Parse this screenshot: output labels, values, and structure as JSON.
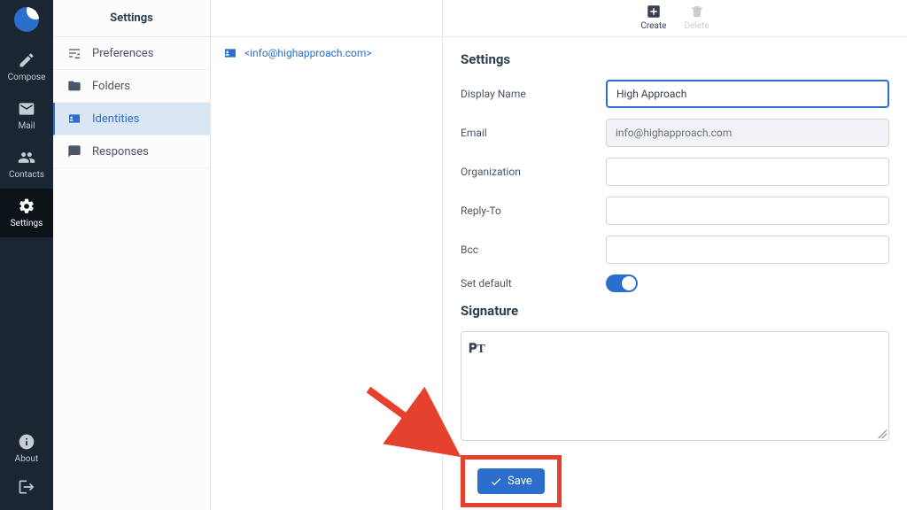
{
  "nav": {
    "compose": "Compose",
    "mail": "Mail",
    "contacts": "Contacts",
    "settings": "Settings",
    "about": "About"
  },
  "settings_col": {
    "title": "Settings",
    "items": [
      {
        "label": "Preferences"
      },
      {
        "label": "Folders"
      },
      {
        "label": "Identities"
      },
      {
        "label": "Responses"
      }
    ]
  },
  "identity_list": {
    "item_email": "<info@highapproach.com>"
  },
  "toolbar": {
    "create": "Create",
    "delete": "Delete"
  },
  "form": {
    "section_settings": "Settings",
    "display_name_label": "Display Name",
    "display_name_value": "High Approach",
    "email_label": "Email",
    "email_value": "info@highapproach.com",
    "organization_label": "Organization",
    "organization_value": "",
    "replyto_label": "Reply-To",
    "replyto_value": "",
    "bcc_label": "Bcc",
    "bcc_value": "",
    "set_default_label": "Set default",
    "set_default_on": true,
    "section_signature": "Signature",
    "signature_value": "",
    "save_label": "Save"
  },
  "colors": {
    "accent": "#2c6ecb",
    "annotation": "#e6412d"
  }
}
